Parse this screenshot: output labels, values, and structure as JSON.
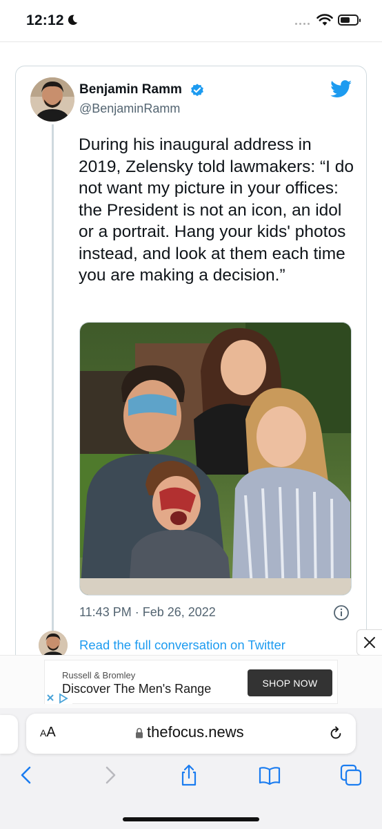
{
  "status_bar": {
    "time": "12:12"
  },
  "tweet": {
    "author_name": "Benjamin Ramm",
    "author_handle": "@BenjaminRamm",
    "text": "During his inaugural address in 2019, Zelensky told lawmakers: “I do not want my picture in your offices: the President is not an icon, an idol or a portrait. Hang your kids' photos instead, and look at them each time you are making a decision.”",
    "timestamp": "11:43 PM · Feb 26, 2022",
    "read_link": "Read the full conversation on Twitter",
    "colors": {
      "link": "#1d9bf0",
      "verified": "#1d9bf0",
      "twitter_logo": "#1d9bf0"
    }
  },
  "ad": {
    "brand": "Russell & Bromley",
    "headline": "Discover The Men's Range",
    "cta": "SHOP NOW"
  },
  "browser": {
    "aa_label": "AA",
    "url": "thefocus.news"
  },
  "icons": [
    "moon-icon",
    "wifi-icon",
    "battery-icon",
    "verified-icon",
    "twitter-logo-icon",
    "info-icon",
    "close-icon",
    "adchoices-icon",
    "lock-icon",
    "reload-icon",
    "back-icon",
    "forward-icon",
    "share-icon",
    "bookmarks-icon",
    "tabs-icon"
  ]
}
